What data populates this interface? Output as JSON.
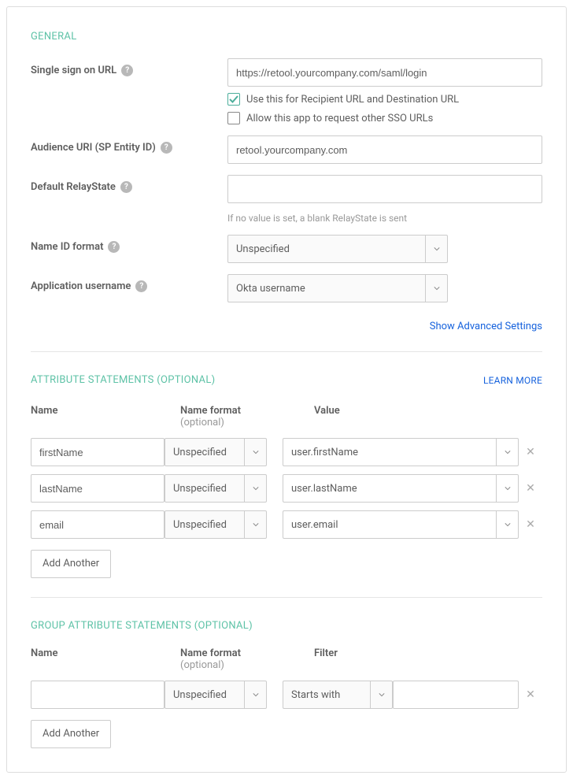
{
  "general": {
    "title": "GENERAL",
    "sso_url": {
      "label": "Single sign on URL",
      "value": "https://retool.yourcompany.com/saml/login"
    },
    "use_for_recipient": {
      "label": "Use this for Recipient URL and Destination URL",
      "checked": true
    },
    "allow_request_sso": {
      "label": "Allow this app to request other SSO URLs",
      "checked": false
    },
    "audience_uri": {
      "label": "Audience URI (SP Entity ID)",
      "value": "retool.yourcompany.com"
    },
    "relaystate": {
      "label": "Default RelayState",
      "value": "",
      "hint": "If no value is set, a blank RelayState is sent"
    },
    "name_id_format": {
      "label": "Name ID format",
      "value": "Unspecified"
    },
    "app_username": {
      "label": "Application username",
      "value": "Okta username"
    },
    "advanced_link": "Show Advanced Settings"
  },
  "attributes": {
    "title": "ATTRIBUTE STATEMENTS (OPTIONAL)",
    "learn_more": "LEARN MORE",
    "headers": {
      "name": "Name",
      "format": "Name format",
      "optional": "(optional)",
      "value": "Value"
    },
    "rows": [
      {
        "name": "firstName",
        "format": "Unspecified",
        "value": "user.firstName"
      },
      {
        "name": "lastName",
        "format": "Unspecified",
        "value": "user.lastName"
      },
      {
        "name": "email",
        "format": "Unspecified",
        "value": "user.email"
      }
    ],
    "add_button": "Add Another"
  },
  "group_attributes": {
    "title": "GROUP ATTRIBUTE STATEMENTS (OPTIONAL)",
    "headers": {
      "name": "Name",
      "format": "Name format",
      "optional": "(optional)",
      "filter": "Filter"
    },
    "rows": [
      {
        "name": "",
        "format": "Unspecified",
        "filter_op": "Starts with",
        "filter_value": ""
      }
    ],
    "add_button": "Add Another"
  }
}
